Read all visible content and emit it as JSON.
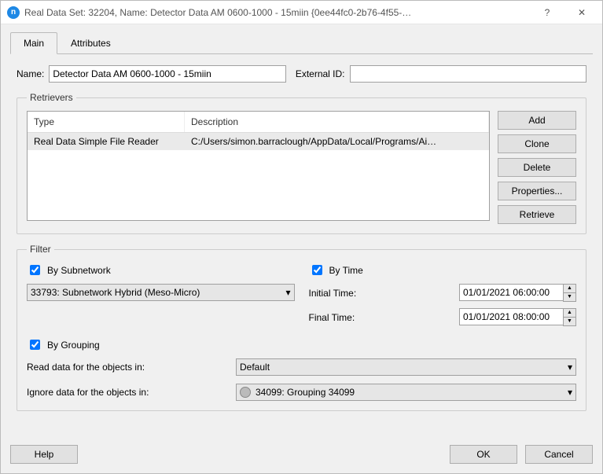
{
  "window": {
    "title": "Real Data Set: 32204, Name: Detector Data AM 0600-1000 - 15miin  {0ee44fc0-2b76-4f55-…",
    "help_glyph": "?",
    "close_glyph": "✕"
  },
  "tabs": {
    "main": "Main",
    "attributes": "Attributes"
  },
  "name_row": {
    "label": "Name:",
    "value": "Detector Data AM 0600-1000 - 15miin",
    "external_label": "External ID:",
    "external_value": ""
  },
  "retrievers": {
    "legend": "Retrievers",
    "head_type": "Type",
    "head_desc": "Description",
    "row_type": "Real Data Simple File Reader",
    "row_desc": "C:/Users/simon.barraclough/AppData/Local/Programs/Ai…",
    "buttons": {
      "add": "Add",
      "clone": "Clone",
      "delete": "Delete",
      "properties": "Properties...",
      "retrieve": "Retrieve"
    }
  },
  "filter": {
    "legend": "Filter",
    "by_subnetwork": "By Subnetwork",
    "subnetwork_value": "33793: Subnetwork Hybrid (Meso-Micro)",
    "by_time": "By Time",
    "initial_time_label": "Initial Time:",
    "initial_time_value": "01/01/2021 06:00:00",
    "final_time_label": "Final Time:",
    "final_time_value": "01/01/2021 08:00:00",
    "by_grouping": "By Grouping",
    "read_label": "Read data for the objects in:",
    "read_value": "Default",
    "ignore_label": "Ignore data for the objects in:",
    "ignore_value": "34099: Grouping 34099"
  },
  "footer": {
    "help": "Help",
    "ok": "OK",
    "cancel": "Cancel"
  }
}
